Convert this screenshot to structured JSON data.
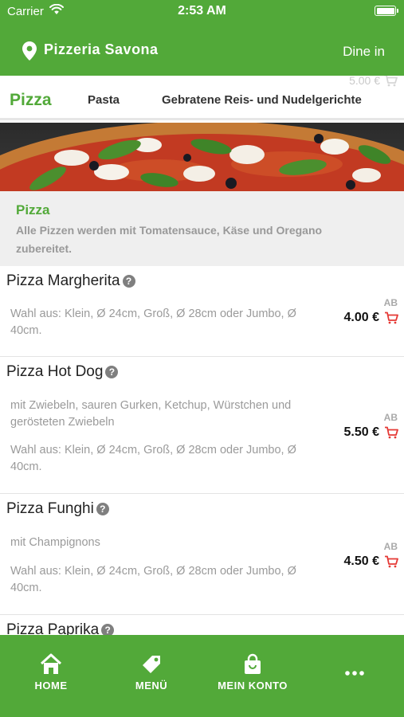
{
  "status_bar": {
    "carrier": "Carrier",
    "time": "2:53 AM"
  },
  "header": {
    "title": "Pizzeria Savona",
    "mode": "Dine in"
  },
  "cart_summary": {
    "total": "5.00 €"
  },
  "tabs": [
    {
      "label": "Pizza",
      "active": true
    },
    {
      "label": "Pasta",
      "active": false
    },
    {
      "label": "Gebratene Reis- und Nudelgerichte",
      "active": false
    }
  ],
  "category": {
    "title": "Pizza",
    "description": "Alle Pizzen werden mit Tomatensauce, Käse und Oregano zubereitet."
  },
  "items": [
    {
      "name": "Pizza Margherita",
      "lines": [
        "Wahl aus: Klein, Ø 24cm, Groß, Ø 28cm oder Jumbo, Ø 40cm."
      ],
      "ab": "AB",
      "price": "4.00 €"
    },
    {
      "name": "Pizza Hot Dog",
      "lines": [
        "mit Zwiebeln, sauren Gurken, Ketchup, Würstchen und gerösteten Zwiebeln",
        "Wahl aus: Klein, Ø 24cm, Groß, Ø 28cm oder Jumbo, Ø 40cm."
      ],
      "ab": "AB",
      "price": "5.50 €"
    },
    {
      "name": "Pizza Funghi",
      "lines": [
        "mit Champignons",
        "Wahl aus: Klein, Ø 24cm, Groß, Ø 28cm oder Jumbo, Ø 40cm."
      ],
      "ab": "AB",
      "price": "4.50 €"
    },
    {
      "name": "Pizza Paprika"
    }
  ],
  "bottom_nav": [
    {
      "label": "HOME",
      "icon": "home-icon"
    },
    {
      "label": "MENÜ",
      "icon": "tag-icon"
    },
    {
      "label": "MEIN KONTO",
      "icon": "bag-icon"
    },
    {
      "label": "",
      "icon": "more-icon"
    }
  ],
  "colors": {
    "brand_green": "#52a939",
    "cart_red": "#e53935",
    "muted_text": "#9a9a9a"
  },
  "help_glyph": "?"
}
